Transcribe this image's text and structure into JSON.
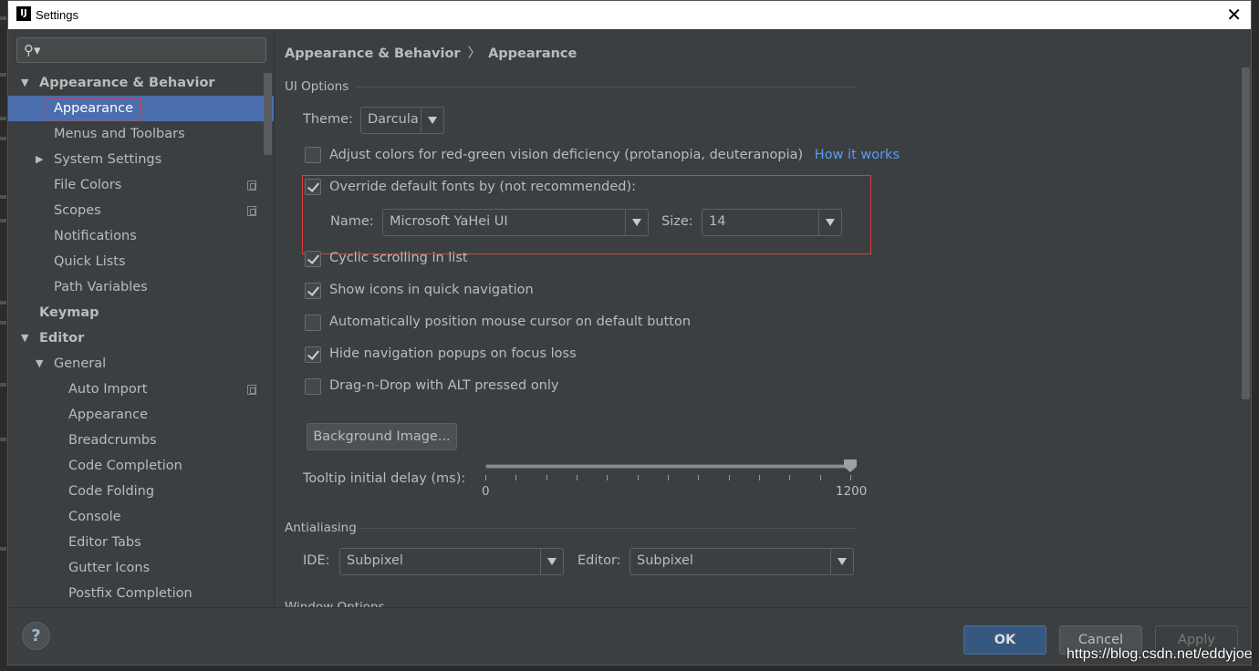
{
  "window": {
    "title": "Settings",
    "app_icon": "IJ"
  },
  "search": {
    "placeholder": ""
  },
  "sidebar": {
    "items": [
      {
        "label": "Appearance & Behavior"
      },
      {
        "label": "Appearance"
      },
      {
        "label": "Menus and Toolbars"
      },
      {
        "label": "System Settings"
      },
      {
        "label": "File Colors"
      },
      {
        "label": "Scopes"
      },
      {
        "label": "Notifications"
      },
      {
        "label": "Quick Lists"
      },
      {
        "label": "Path Variables"
      },
      {
        "label": "Keymap"
      },
      {
        "label": "Editor"
      },
      {
        "label": "General"
      },
      {
        "label": "Auto Import"
      },
      {
        "label": "Appearance"
      },
      {
        "label": "Breadcrumbs"
      },
      {
        "label": "Code Completion"
      },
      {
        "label": "Code Folding"
      },
      {
        "label": "Console"
      },
      {
        "label": "Editor Tabs"
      },
      {
        "label": "Gutter Icons"
      },
      {
        "label": "Postfix Completion"
      }
    ]
  },
  "breadcrumb": {
    "parent": "Appearance & Behavior",
    "separator": "〉",
    "current": "Appearance"
  },
  "ui_options": {
    "section_title": "UI Options",
    "theme_label": "Theme:",
    "theme_value": "Darcula",
    "adjust_colors": {
      "label": "Adjust colors for red-green vision deficiency (protanopia, deuteranopia)",
      "link": "How it works",
      "checked": false
    },
    "override_fonts": {
      "label": "Override default fonts by (not recommended):",
      "checked": true
    },
    "font_name_label": "Name:",
    "font_name_value": "Microsoft YaHei UI",
    "font_size_label": "Size:",
    "font_size_value": "14",
    "cyclic_scrolling": {
      "label": "Cyclic scrolling in list",
      "checked": true
    },
    "show_icons": {
      "label": "Show icons in quick navigation",
      "checked": true
    },
    "auto_position": {
      "label": "Automatically position mouse cursor on default button",
      "checked": false
    },
    "hide_popups": {
      "label": "Hide navigation popups on focus loss",
      "checked": true
    },
    "drag_drop": {
      "label": "Drag-n-Drop with ALT pressed only",
      "checked": false
    },
    "background_image_button": "Background Image...",
    "tooltip_label": "Tooltip initial delay (ms):",
    "tooltip_min": "0",
    "tooltip_max": "1200",
    "tooltip_value": 1200
  },
  "antialiasing": {
    "section_title": "Antialiasing",
    "ide_label": "IDE:",
    "ide_value": "Subpixel",
    "editor_label": "Editor:",
    "editor_value": "Subpixel"
  },
  "window_options": {
    "section_title": "Window Options"
  },
  "footer": {
    "help": "?",
    "ok": "OK",
    "cancel": "Cancel",
    "apply": "Apply",
    "watermark": "https://blog.csdn.net/eddyjoe"
  },
  "colors": {
    "accent": "#4b6eaf",
    "highlight_box": "#e03b3b",
    "link": "#589df6",
    "ok_button": "#365880"
  }
}
